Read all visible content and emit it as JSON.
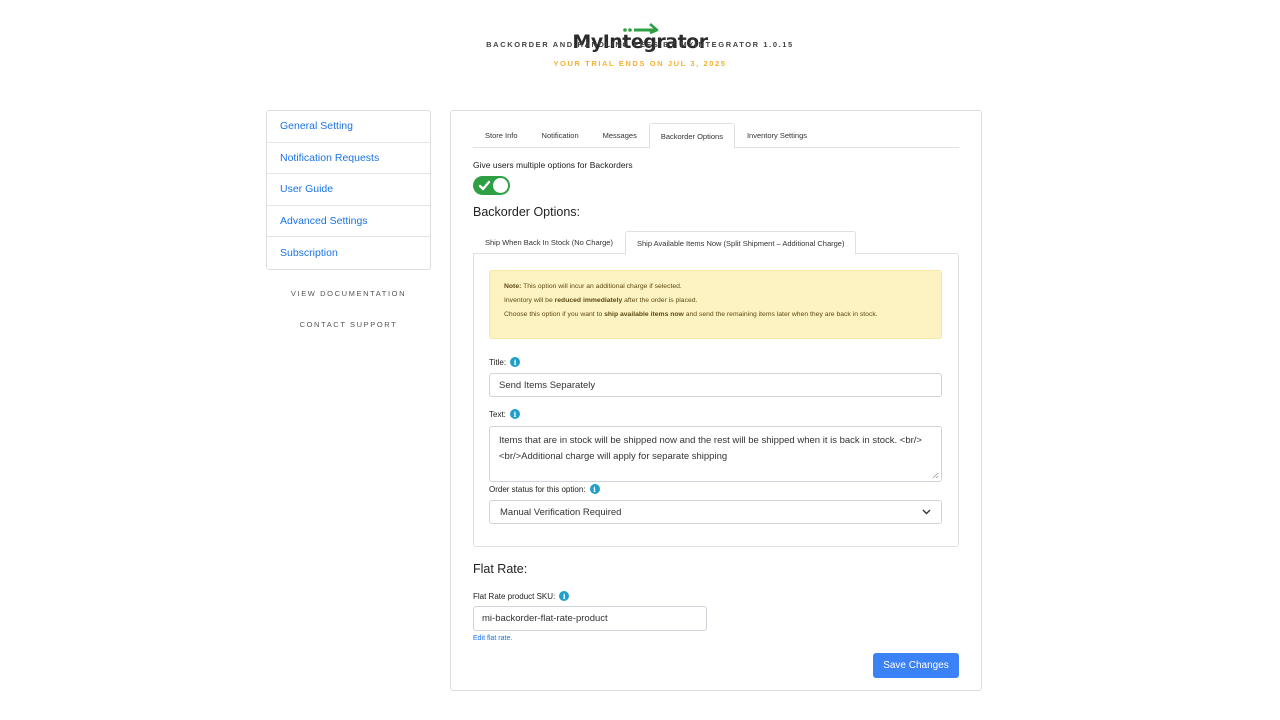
{
  "header": {
    "logo_text": "MyIntegrator",
    "subtitle": "BACKORDER AND HANDLING FEES BY MYINTEGRATOR 1.0.15",
    "trial_notice": "YOUR TRIAL ENDS ON JUL 3, 2025"
  },
  "colors": {
    "link": "#1a73e8",
    "toggle_on": "#2ea043",
    "trial_text": "#f2b233",
    "note_bg": "#fcf2c2",
    "primary_button": "#3b82f6",
    "info_icon": "#1ea0c8"
  },
  "sidebar": {
    "items": [
      {
        "label": "General Setting"
      },
      {
        "label": "Notification Requests"
      },
      {
        "label": "User Guide"
      },
      {
        "label": "Advanced Settings"
      },
      {
        "label": "Subscription"
      }
    ],
    "view_documentation": "VIEW DOCUMENTATION",
    "contact_support": "CONTACT SUPPORT"
  },
  "main": {
    "tabs": [
      {
        "label": "Store Info"
      },
      {
        "label": "Notification"
      },
      {
        "label": "Messages"
      },
      {
        "label": "Backorder Options",
        "active": true
      },
      {
        "label": "Inventory Settings"
      }
    ],
    "toggle_label": "Give users multiple options for Backorders",
    "toggle_on": true,
    "backorder_options_title": "Backorder Options:",
    "subtabs": [
      {
        "label": "Ship When Back In Stock (No Charge)"
      },
      {
        "label": "Ship Available Items Now (Split Shipment – Additional Charge)",
        "active": true
      }
    ],
    "note": {
      "line1_bold": "Note:",
      "line1_rest": " This option will incur an additional charge if selected.",
      "line2_pre": "Inventory will be ",
      "line2_bold": "reduced immediately",
      "line2_post": " after the order is placed.",
      "line3_pre": "Choose this option if you want to ",
      "line3_bold": "ship available items now",
      "line3_post": " and send the remaining items later when they are back in stock."
    },
    "title_label": "Title:",
    "title_value": "Send Items Separately",
    "text_label": "Text:",
    "text_value": "Items that are in stock will be shipped now and the rest will be shipped when it is back in stock. <br/><br/>Additional charge will apply for separate shipping",
    "order_status_label": "Order status for this option:",
    "order_status_value": "Manual Verification Required",
    "flat_rate_title": "Flat Rate:",
    "flat_rate_sku_label": "Flat Rate product SKU:",
    "flat_rate_sku_value": "mi-backorder-flat-rate-product",
    "edit_flat_rate": "Edit flat rate.",
    "save_label": "Save Changes"
  },
  "icons": {
    "info": "info-icon",
    "toggle_check": "check-icon",
    "select_chevron": "chevron-down-icon"
  }
}
